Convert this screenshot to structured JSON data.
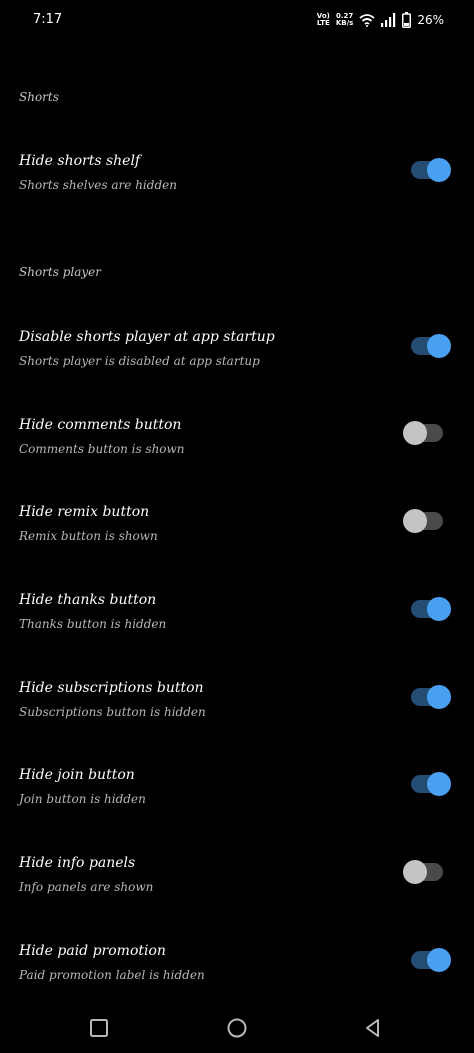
{
  "status_bar": {
    "time": "7:17",
    "volte_top": "Vo)",
    "volte_bottom": "LTE",
    "speed_value": "0.27",
    "speed_unit": "KB/s",
    "battery_percent": "26%",
    "icons": [
      "volte-icon",
      "wifi-icon",
      "signal-icon",
      "battery-icon"
    ]
  },
  "sections": [
    {
      "header": "Shorts",
      "items": [
        {
          "title": "Hide shorts shelf",
          "summary": "Shorts shelves are hidden",
          "enabled": true
        }
      ]
    },
    {
      "header": "Shorts player",
      "items": [
        {
          "title": "Disable shorts player at app startup",
          "summary": "Shorts player is disabled at app startup",
          "enabled": true
        },
        {
          "title": "Hide comments button",
          "summary": "Comments button is shown",
          "enabled": false
        },
        {
          "title": "Hide remix button",
          "summary": "Remix button is shown",
          "enabled": false
        },
        {
          "title": "Hide thanks button",
          "summary": "Thanks button is hidden",
          "enabled": true
        },
        {
          "title": "Hide subscriptions button",
          "summary": "Subscriptions button is hidden",
          "enabled": true
        },
        {
          "title": "Hide join button",
          "summary": "Join button is hidden",
          "enabled": true
        },
        {
          "title": "Hide info panels",
          "summary": "Info panels are shown",
          "enabled": false
        },
        {
          "title": "Hide paid promotion",
          "summary": "Paid promotion label is hidden",
          "enabled": true
        }
      ]
    }
  ],
  "colors": {
    "background": "#000000",
    "toggle_on_thumb": "#4aa0f0",
    "toggle_on_track": "#254d73",
    "toggle_off_thumb": "#c4c4c4",
    "toggle_off_track": "#4a4a4a"
  },
  "nav_bar": {
    "icons": [
      "recents-square-icon",
      "home-circle-icon",
      "back-triangle-icon"
    ]
  }
}
